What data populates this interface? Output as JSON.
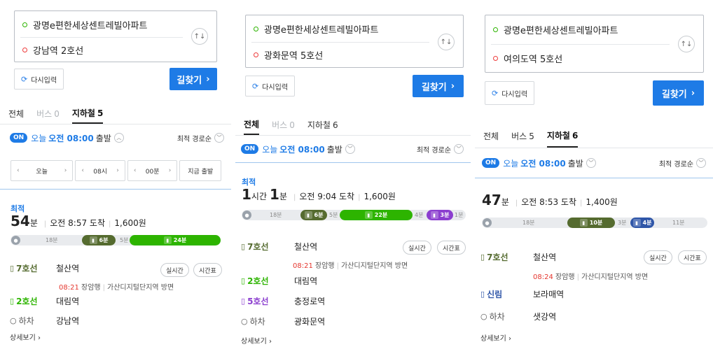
{
  "common": {
    "origin": "광명e편한세상센트레빌아파트",
    "reset_label": "다시입력",
    "search_label": "길찾기",
    "today": "오늘",
    "time": "오전 08:00",
    "depart": "출발",
    "sort": "최적 경로순",
    "alight": "하차",
    "detail": "상세보기",
    "realtime": "실시간",
    "timetable": "시간표",
    "best": "최적",
    "fare_sep": "|"
  },
  "panel1": {
    "destination": "강남역 2호선",
    "tabs": [
      {
        "label": "전체",
        "count": ""
      },
      {
        "label": "버스",
        "count": "0"
      },
      {
        "label": "지하철",
        "count": "5"
      }
    ],
    "timepicker": {
      "day": "오늘",
      "hour": "08시",
      "minute": "00분",
      "now": "지금 출발"
    },
    "duration_num": "54",
    "duration_unit": "분",
    "arrival": "오전 8:57 도착",
    "fare": "1,600원",
    "timeline": {
      "walk1": "18분",
      "line7": "6분",
      "walk2": "5분",
      "line2": "24분"
    },
    "steps": [
      {
        "line": "7호선",
        "station": "철산역"
      },
      {
        "line": "2호선",
        "station": "대림역"
      },
      {
        "line": "하차",
        "station": "강남역"
      }
    ],
    "sub_time": "08:21",
    "sub_dir": "장암행",
    "sub_exit": "가산디지털단지역 방면"
  },
  "panel2": {
    "destination": "광화문역 5호선",
    "tabs": [
      {
        "label": "전체",
        "count": ""
      },
      {
        "label": "버스",
        "count": "0"
      },
      {
        "label": "지하철",
        "count": "6"
      }
    ],
    "duration_h": "1",
    "duration_h_unit": "시간",
    "duration_m": "1",
    "duration_m_unit": "분",
    "arrival": "오전 9:04 도착",
    "fare": "1,600원",
    "timeline": {
      "walk1": "18분",
      "line7": "6분",
      "walk2": "5분",
      "line2": "22분",
      "walk3": "4분",
      "line5": "3분",
      "walk4": "1분"
    },
    "steps": [
      {
        "line": "7호선",
        "station": "철산역"
      },
      {
        "line": "2호선",
        "station": "대림역"
      },
      {
        "line": "5호선",
        "station": "충정로역"
      },
      {
        "line": "하차",
        "station": "광화문역"
      }
    ],
    "sub_time": "08:21",
    "sub_dir": "장암행",
    "sub_exit": "가산디지털단지역 방면"
  },
  "panel3": {
    "destination": "여의도역 5호선",
    "tabs": [
      {
        "label": "전체",
        "count": ""
      },
      {
        "label": "버스",
        "count": "5"
      },
      {
        "label": "지하철",
        "count": "6"
      }
    ],
    "duration_num": "47",
    "duration_unit": "분",
    "arrival": "오전 8:53 도착",
    "fare": "1,400원",
    "timeline": {
      "walk1": "18분",
      "line7": "10분",
      "walk2": "3분",
      "lines": "4분",
      "walk3": "11분"
    },
    "steps": [
      {
        "line": "7호선",
        "station": "철산역"
      },
      {
        "line": "신림",
        "station": "보라매역"
      },
      {
        "line": "하차",
        "station": "샛강역"
      }
    ],
    "sub_time": "08:24",
    "sub_dir": "장암행",
    "sub_exit": "가산디지털단지역 방면"
  },
  "colors": {
    "line7": "#556b2f",
    "line2": "#2db400",
    "line5": "#8b3ecf",
    "sillim": "#2f56a8",
    "accent": "#1e7be6"
  }
}
